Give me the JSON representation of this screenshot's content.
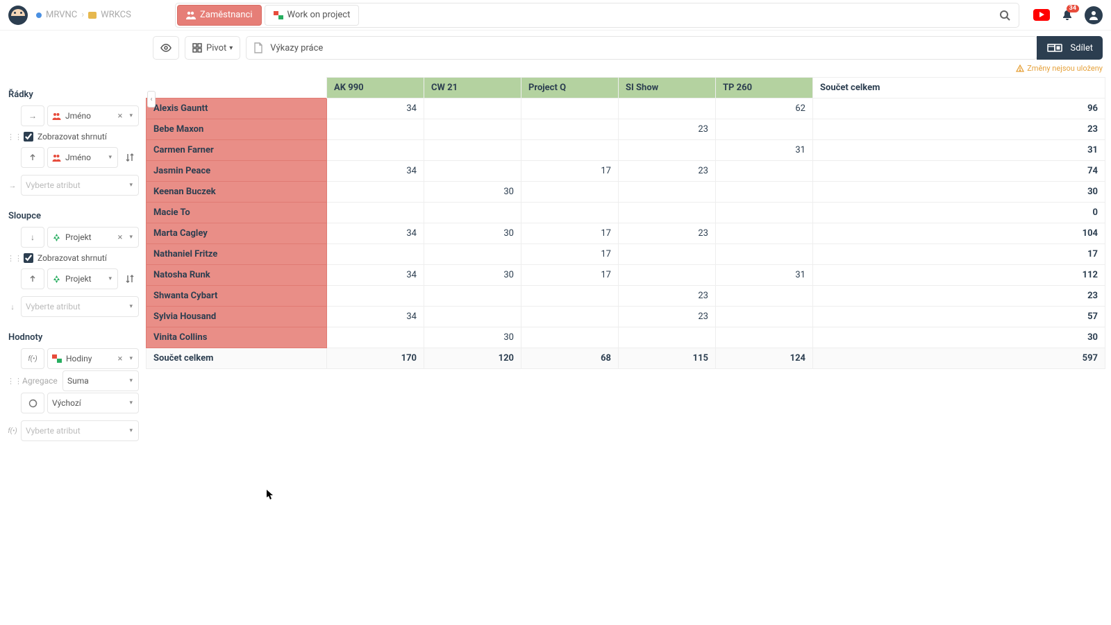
{
  "breadcrumb": {
    "project": "MRVNC",
    "table": "WRKCS"
  },
  "tabs": [
    {
      "label": "Zaměstnanci",
      "active": true,
      "icon": "users"
    },
    {
      "label": "Work on project",
      "active": false,
      "icon": "link-mix"
    }
  ],
  "notifications_count": "34",
  "toolbar": {
    "pivot_label": "Pivot",
    "title": "Výkazy práce",
    "share": "Sdílet"
  },
  "unsaved_warning": "Změny nejsou uloženy",
  "sidebar": {
    "rows_title": "Řádky",
    "columns_title": "Sloupce",
    "values_title": "Hodnoty",
    "show_summary": "Zobrazovat shrnutí",
    "placeholder": "Vyberte atribut",
    "name_attr": "Jméno",
    "project_attr": "Projekt",
    "hours_attr": "Hodiny",
    "agg_label": "Agregace",
    "agg_value": "Suma",
    "color_value": "Výchozí"
  },
  "pivot": {
    "total_label": "Součet celkem",
    "columns": [
      "AK 990",
      "CW 21",
      "Project Q",
      "SI Show",
      "TP 260"
    ],
    "rows": [
      {
        "name": "Alexis Gauntt",
        "v": [
          "34",
          "",
          "",
          "",
          "62"
        ],
        "t": "96"
      },
      {
        "name": "Bebe Maxon",
        "v": [
          "",
          "",
          "",
          "23",
          ""
        ],
        "t": "23"
      },
      {
        "name": "Carmen Farner",
        "v": [
          "",
          "",
          "",
          "",
          "31"
        ],
        "t": "31"
      },
      {
        "name": "Jasmin Peace",
        "v": [
          "34",
          "",
          "17",
          "23",
          ""
        ],
        "t": "74"
      },
      {
        "name": "Keenan Buczek",
        "v": [
          "",
          "30",
          "",
          "",
          ""
        ],
        "t": "30"
      },
      {
        "name": "Macie To",
        "v": [
          "",
          "",
          "",
          "",
          ""
        ],
        "t": "0"
      },
      {
        "name": "Marta Cagley",
        "v": [
          "34",
          "30",
          "17",
          "23",
          ""
        ],
        "t": "104"
      },
      {
        "name": "Nathaniel Fritze",
        "v": [
          "",
          "",
          "17",
          "",
          ""
        ],
        "t": "17"
      },
      {
        "name": "Natosha Runk",
        "v": [
          "34",
          "30",
          "17",
          "",
          "31"
        ],
        "t": "112"
      },
      {
        "name": "Shwanta Cybart",
        "v": [
          "",
          "",
          "",
          "23",
          ""
        ],
        "t": "23"
      },
      {
        "name": "Sylvia Housand",
        "v": [
          "34",
          "",
          "",
          "23",
          ""
        ],
        "t": "57"
      },
      {
        "name": "Vinita Collins",
        "v": [
          "",
          "30",
          "",
          "",
          ""
        ],
        "t": "30"
      }
    ],
    "col_totals": [
      "170",
      "120",
      "68",
      "115",
      "124"
    ],
    "grand_total": "597"
  }
}
